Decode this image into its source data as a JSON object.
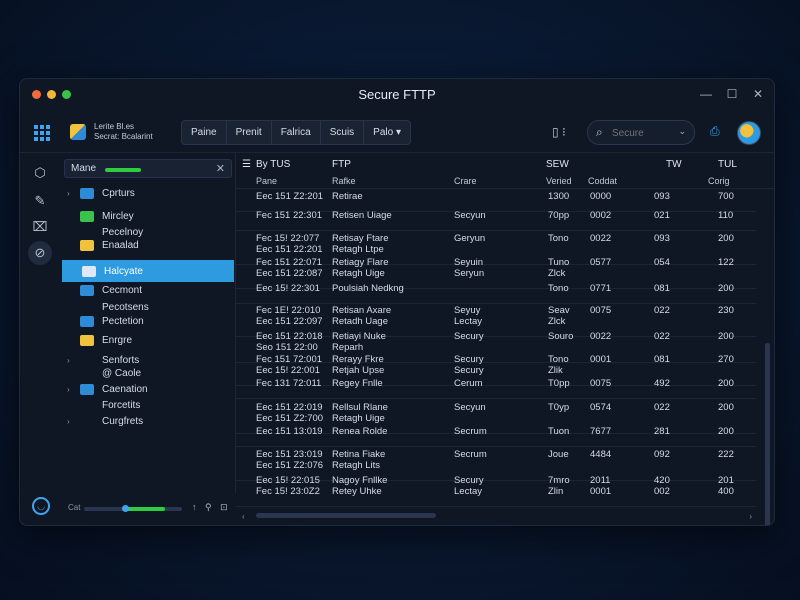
{
  "window": {
    "title": "Secure FTTP",
    "dots": [
      "#f26b3a",
      "#f2b63a",
      "#3ac24a"
    ],
    "controls": [
      "—",
      "☐",
      "✕"
    ]
  },
  "toolbar": {
    "brand_line1": "Lerite Bl.es",
    "brand_line2": "Secrat: Bcalarint",
    "btn_primary": "Paine",
    "group": [
      "Prenit",
      "Falrica",
      "Scuis",
      "Palo ▾"
    ],
    "search_placeholder": "Secure"
  },
  "rail": [
    "⬡",
    "✎",
    "⌧",
    "⊘"
  ],
  "tree": {
    "search_label": "Mane",
    "nodes": [
      {
        "label": "Cprturs",
        "arrow": "›",
        "color": "#2e8bd6"
      },
      {
        "label": "Mircley",
        "arrow": "",
        "color": "#3ac24a"
      },
      {
        "label": "Pecelnoy",
        "arrow": "",
        "color": ""
      },
      {
        "label": "Enaalad",
        "arrow": "",
        "color": "#f0c23e"
      },
      {
        "label": "Halcyate",
        "arrow": "",
        "color": "#dfe9f5",
        "selected": true
      },
      {
        "label": "Cecmont",
        "arrow": "",
        "color": "#2e8bd6"
      },
      {
        "label": "Pecotsens",
        "arrow": "",
        "color": ""
      },
      {
        "label": "Pectetion",
        "arrow": "",
        "color": "#2e8bd6"
      },
      {
        "label": "Enrgre",
        "arrow": "",
        "color": "#f0c23e"
      },
      {
        "label": "Senforts",
        "arrow": "›",
        "color": ""
      },
      {
        "label": "@ Caole",
        "arrow": "",
        "color": ""
      },
      {
        "label": "Caenation",
        "arrow": "›",
        "color": "#2e8bd6"
      },
      {
        "label": "Forcetits",
        "arrow": "",
        "color": ""
      },
      {
        "label": "Curgfrets",
        "arrow": "›",
        "color": ""
      }
    ],
    "bottom_label": "Cat",
    "bottom_icons": "↑ ⚲ ⊡",
    "progress": 0.42
  },
  "table": {
    "headers": [
      "By TUS",
      "FTP",
      "SEW",
      "TW",
      "TUL"
    ],
    "subheaders": [
      "Pane",
      "Rafke",
      "Crare",
      "Veried",
      "Coddat",
      "Corig"
    ],
    "rows": [
      {
        "a": "Eec 151 Z2:201",
        "b": "Retirae",
        "c": "",
        "d": "1300",
        "e": "0000",
        "f": "093",
        "g": "700"
      },
      {
        "a": "Fec 151 22:301",
        "b": "Retisen Uiage",
        "c": "Secyun",
        "d": "70pp",
        "e": "0002",
        "f": "021",
        "g": "110"
      },
      {
        "a": "Fec 15! 22:077\nEec 151 22:201",
        "b": "Retisay Ftare\nRetagh Ltpe",
        "c": "Geryun",
        "d": "Tono",
        "e": "0022",
        "f": "093",
        "g": "200"
      },
      {
        "a": "Fec 151 22:071\nEec 151 22:087",
        "b": "Retiagy Flare\nRetagh Uige",
        "c": "Seyuin\nSeryun",
        "d": "Tuno\nZlck",
        "e": "0577",
        "f": "054",
        "g": "122"
      },
      {
        "a": "Eec 15! 22:301",
        "b": "Poulsiah Nedkng",
        "c": "",
        "d": "Tono",
        "e": "0771",
        "f": "081",
        "g": "200"
      },
      {
        "a": "Fec 1E! 22:010\nEec 151 22:097",
        "b": "Retisan Axare\nRetadh Uage",
        "c": "Seyuy\nLectay",
        "d": "Seav\nZlck",
        "e": "0075",
        "f": "022",
        "g": "230"
      },
      {
        "a": "Eec 151 22:018\nSeo 151 22:00",
        "b": "Retiayi Nuke\nReparh",
        "c": "Secury",
        "d": "Souro",
        "e": "0022",
        "f": "022",
        "g": "200"
      },
      {
        "a": "Fec 151 72:001\nEec 15! 22:001",
        "b": "Rerayy Fkre\nRetjah Upse",
        "c": "Secury\nSecury",
        "d": "Tono\nZlik",
        "e": "0001",
        "f": "081",
        "g": "270"
      },
      {
        "a": "Fec 131 72:011",
        "b": "Regey Fnlle",
        "c": "Cerum",
        "d": "T0pp",
        "e": "0075",
        "f": "492",
        "g": "200"
      },
      {
        "a": "Eec 151 22:019\nEec 151 Z2:700",
        "b": "Rellsul Rlane\nRetagh Uige",
        "c": "Secyun",
        "d": "T0yp",
        "e": "0574",
        "f": "022",
        "g": "200"
      },
      {
        "a": "Eec 151 13:019",
        "b": "Renea Rolde",
        "c": "Secrum",
        "d": "Tuon",
        "e": "7677",
        "f": "281",
        "g": "200"
      },
      {
        "a": "Eec 151 23:019\nEec 151 Z2:076",
        "b": "Retina Fiake\nRetagh Lits",
        "c": "Secrum",
        "d": "Joue",
        "e": "4484",
        "f": "092",
        "g": "222"
      },
      {
        "a": "Eec 15! 22:015\nFec 15! 23:0Z2",
        "b": "Nagoy Fnllke\nRetey Uhke",
        "c": "Secury\nLectay",
        "d": "7mro\nZlin",
        "e": "2011\n0001",
        "f": "420\n002",
        "g": "201\n400"
      }
    ]
  }
}
